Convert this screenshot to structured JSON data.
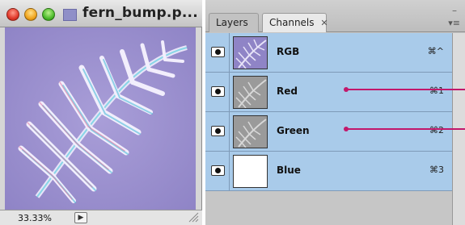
{
  "document": {
    "title": "fern_bump.p...",
    "zoom": "33.33%",
    "status_menu_glyph": "▶",
    "icons": [
      "close-window-icon",
      "minimize-window-icon",
      "zoom-window-icon",
      "document-proxy-icon",
      "resize-grip-icon"
    ]
  },
  "panel": {
    "tabs": [
      {
        "label": "Layers",
        "active": false
      },
      {
        "label": "Channels",
        "active": true
      }
    ],
    "tab_close_glyph": "✕",
    "minimize_glyph": "–",
    "menu_glyph": "▾≡",
    "channels": [
      {
        "name": "RGB",
        "shortcut": "⌘^",
        "visible": true,
        "thumb": "rgb"
      },
      {
        "name": "Red",
        "shortcut": "⌘1",
        "visible": true,
        "thumb": "gray"
      },
      {
        "name": "Green",
        "shortcut": "⌘2",
        "visible": true,
        "thumb": "gray"
      },
      {
        "name": "Blue",
        "shortcut": "⌘3",
        "visible": true,
        "thumb": "white"
      }
    ]
  },
  "colors": {
    "channel_row": "#a9cbea",
    "callout": "#c2186b",
    "canvas_bg": "#9a8fcf"
  }
}
